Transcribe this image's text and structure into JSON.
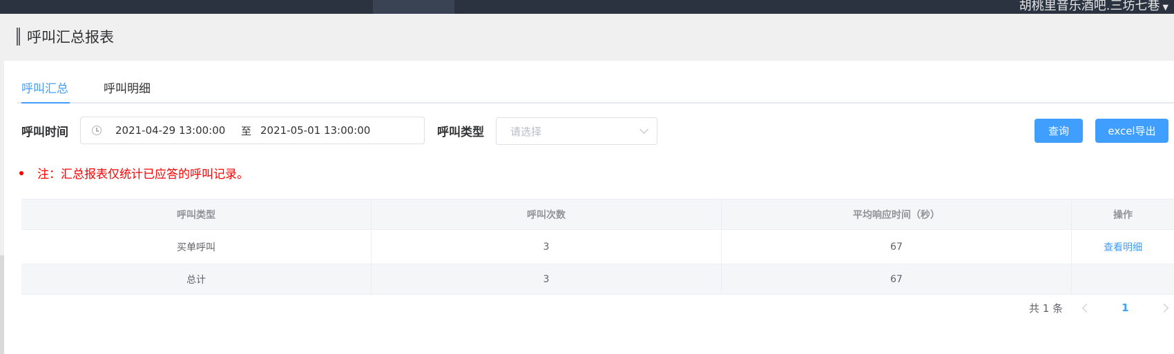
{
  "topbar": {
    "user_label": "胡桃里音乐酒吧.三坊七巷"
  },
  "page": {
    "title": "呼叫汇总报表"
  },
  "tabs": [
    {
      "label": "呼叫汇总",
      "active": true
    },
    {
      "label": "呼叫明细",
      "active": false
    }
  ],
  "filters": {
    "time_label": "呼叫时间",
    "start": "2021-04-29 13:00:00",
    "separator": "至",
    "end": "2021-05-01 13:00:00",
    "type_label": "呼叫类型",
    "type_placeholder": "请选择"
  },
  "buttons": {
    "query": "查询",
    "export": "excel导出"
  },
  "note": "注：汇总报表仅统计已应答的呼叫记录。",
  "table": {
    "columns": [
      "呼叫类型",
      "呼叫次数",
      "平均响应时间（秒）",
      "操作"
    ],
    "rows": [
      {
        "type": "买单呼叫",
        "count": "3",
        "avg": "67",
        "action": "查看明细"
      }
    ],
    "total": {
      "type": "总计",
      "count": "3",
      "avg": "67"
    }
  },
  "pagination": {
    "total_text": "共 1 条",
    "current_page": "1"
  },
  "colors": {
    "accent": "#409eff",
    "topbar": "#2b3340",
    "note": "#ff0000"
  }
}
